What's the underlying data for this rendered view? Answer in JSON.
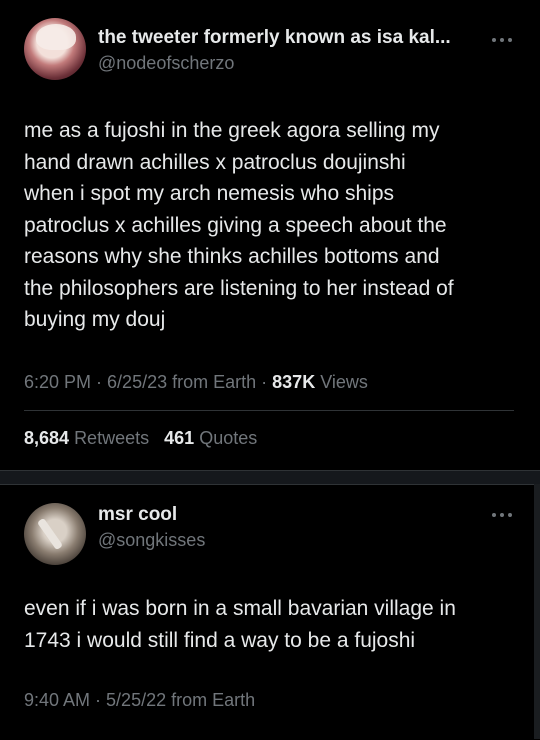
{
  "tweet1": {
    "display_name": "the tweeter formerly known as isa kal...",
    "handle": "@nodeofscherzo",
    "text": "me as a fujoshi in the greek agora selling my\nhand drawn achilles x patroclus doujinshi\nwhen i spot my arch nemesis who ships\npatroclus x achilles giving a speech about the\nreasons why she thinks achilles bottoms and\nthe philosophers are listening to her instead of\nbuying my douj",
    "time": "6:20 PM",
    "date": "6/25/23",
    "source": "from Earth",
    "views_count": "837K",
    "views_label": "Views",
    "retweets_count": "8,684",
    "retweets_label": "Retweets",
    "quotes_count": "461",
    "quotes_label": "Quotes"
  },
  "tweet2": {
    "display_name": "msr cool",
    "handle": "@songkisses",
    "text": "even if i was born in a small bavarian village in\n1743 i would still find a way to be a fujoshi",
    "time": "9:40 AM",
    "date": "5/25/22",
    "source": "from Earth"
  },
  "separator": " · ",
  "colors": {
    "background": "#000000",
    "text": "#e7e9ea",
    "muted": "#71767b",
    "border": "#2f3336"
  },
  "icons": [
    "more-options-icon"
  ]
}
